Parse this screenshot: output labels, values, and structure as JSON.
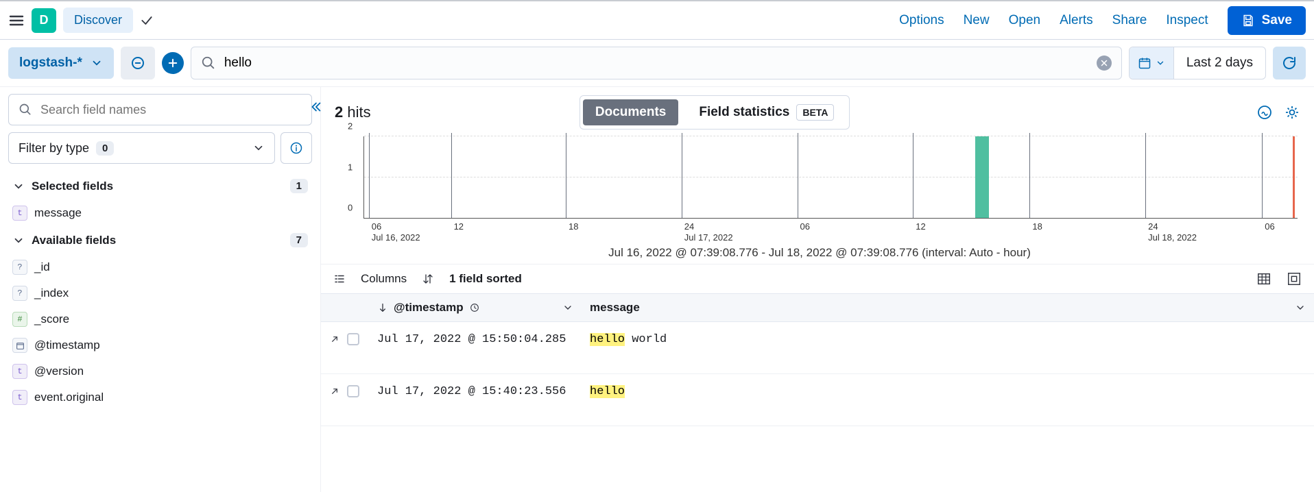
{
  "topbar": {
    "logo_letter": "D",
    "discover_label": "Discover",
    "links": {
      "options": "Options",
      "new": "New",
      "open": "Open",
      "alerts": "Alerts",
      "share": "Share",
      "inspect": "Inspect"
    },
    "save_label": "Save"
  },
  "querybar": {
    "index_pattern": "logstash-*",
    "query_value": "hello",
    "time_range_label": "Last 2 days"
  },
  "sidebar": {
    "search_placeholder": "Search field names",
    "filter_type_label": "Filter by type",
    "filter_type_count": "0",
    "selected_label": "Selected fields",
    "selected_count": "1",
    "selected_fields": [
      {
        "type": "t",
        "name": "message"
      }
    ],
    "available_label": "Available fields",
    "available_count": "7",
    "available_fields": [
      {
        "type": "?",
        "name": "_id"
      },
      {
        "type": "?",
        "name": "_index"
      },
      {
        "type": "#",
        "name": "_score"
      },
      {
        "type": "d",
        "name": "@timestamp"
      },
      {
        "type": "t",
        "name": "@version"
      },
      {
        "type": "t",
        "name": "event.original"
      }
    ]
  },
  "hits": {
    "count": "2",
    "label": "hits"
  },
  "tabs": {
    "documents": "Documents",
    "field_stats": "Field statistics",
    "beta": "BETA"
  },
  "chart_data": {
    "type": "bar",
    "ylabel": "",
    "yticks": [
      0,
      1,
      2
    ],
    "ylim": [
      0,
      2
    ],
    "bars": [
      {
        "x_pct": 65.5,
        "value": 2
      }
    ],
    "nowline_pct": 99.5,
    "xticks": [
      {
        "pct": 0.5,
        "label": "06",
        "sub": "Jul 16, 2022"
      },
      {
        "pct": 9.3,
        "label": "12"
      },
      {
        "pct": 21.6,
        "label": "18"
      },
      {
        "pct": 34.0,
        "label": "24",
        "sub": "Jul 17, 2022"
      },
      {
        "pct": 46.4,
        "label": "06"
      },
      {
        "pct": 58.8,
        "label": "12"
      },
      {
        "pct": 71.3,
        "label": "18"
      },
      {
        "pct": 83.7,
        "label": "24",
        "sub": "Jul 18, 2022"
      },
      {
        "pct": 96.2,
        "label": "06"
      }
    ],
    "caption": "Jul 16, 2022 @ 07:39:08.776 - Jul 18, 2022 @ 07:39:08.776 (interval: Auto - hour)"
  },
  "table": {
    "columns_label": "Columns",
    "sort_label": "1 field sorted",
    "headers": {
      "timestamp": "@timestamp",
      "message": "message"
    },
    "rows": [
      {
        "timestamp": "Jul 17, 2022 @ 15:50:04.285",
        "message_hl": "hello",
        "message_rest": " world"
      },
      {
        "timestamp": "Jul 17, 2022 @ 15:40:23.556",
        "message_hl": "hello",
        "message_rest": ""
      }
    ]
  }
}
